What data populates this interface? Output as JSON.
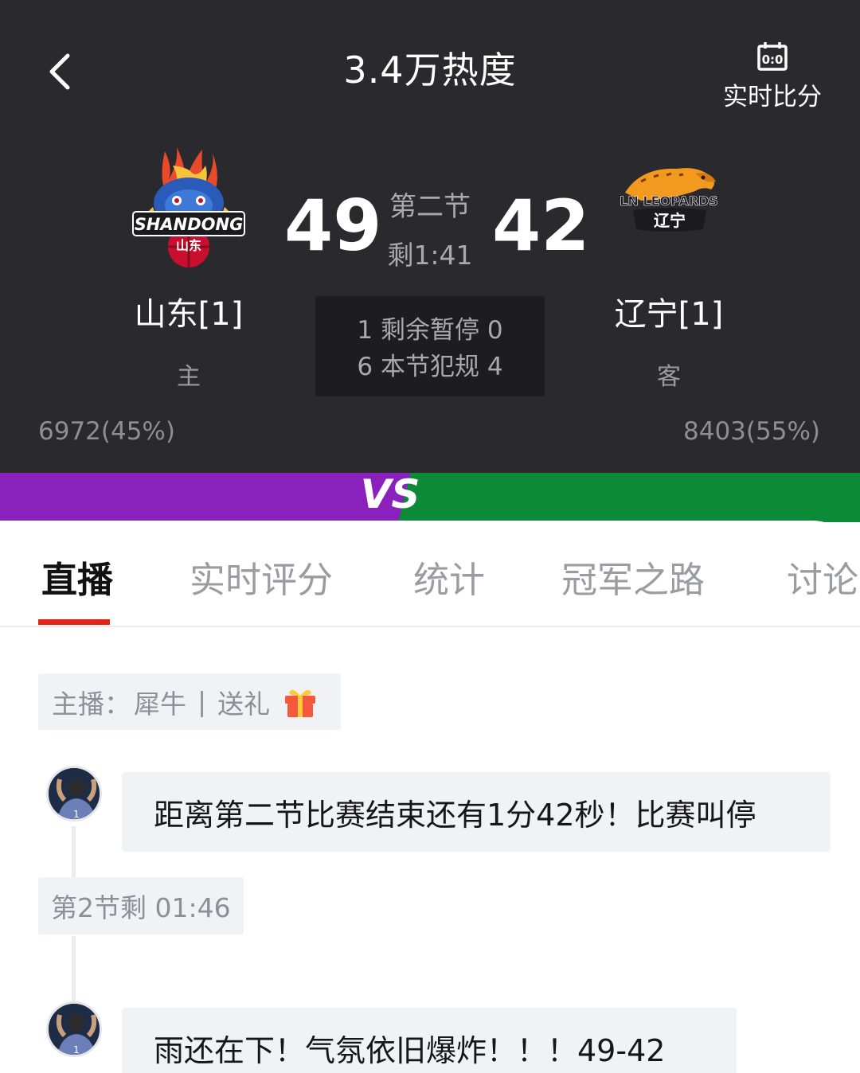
{
  "header": {
    "title": "3.4万热度",
    "live_score_label": "实时比分",
    "live_score_icon_text": "0:0"
  },
  "home": {
    "logo_text": "SHANDONG",
    "logo_text_cn": "山东",
    "name": "山东[1]",
    "side": "主",
    "score": "49",
    "support": "6972(45%)"
  },
  "away": {
    "logo_text": "LN LEOPARDS",
    "logo_text_cn": "辽宁",
    "name": "辽宁[1]",
    "side": "客",
    "score": "42",
    "support": "8403(55%)"
  },
  "game": {
    "period": "第二节",
    "clock": "剩1:41",
    "timeouts_row": "1 剩余暂停 0",
    "fouls_row": "6 本节犯规 4"
  },
  "support_ratio": {
    "home": 0.45,
    "away": 0.55
  },
  "vs_text": "VS",
  "colors": {
    "home": "#8a21bc",
    "away": "#0d8a38",
    "accent": "#e2231a",
    "header_bg": "#2a2a2e"
  },
  "tabs": [
    {
      "label": "直播",
      "active": true
    },
    {
      "label": "实时评分",
      "active": false
    },
    {
      "label": "统计",
      "active": false
    },
    {
      "label": "冠军之路",
      "active": false
    },
    {
      "label": "讨论",
      "active": false
    }
  ],
  "host": {
    "label": "主播：",
    "name": "犀牛",
    "separator": "|",
    "gift_label": "送礼"
  },
  "feed": [
    {
      "type": "message",
      "text": "距离第二节比赛结束还有1分42秒！比赛叫停"
    },
    {
      "type": "time",
      "text": "第2节剩 01:46"
    },
    {
      "type": "message",
      "text": "雨还在下！气氛依旧爆炸！！！49-42"
    }
  ]
}
